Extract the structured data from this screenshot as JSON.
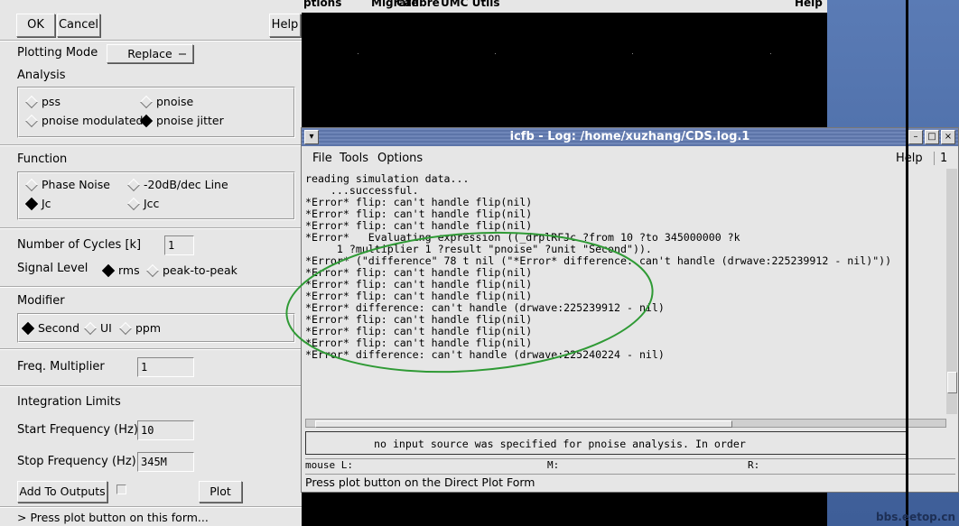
{
  "form": {
    "ok": "OK",
    "cancel": "Cancel",
    "help": "Help",
    "plotting_mode_label": "Plotting Mode",
    "plotting_mode_value": "Replace",
    "analysis_label": "Analysis",
    "analysis_options": [
      "pss",
      "pnoise",
      "pnoise modulated",
      "pnoise jitter"
    ],
    "analysis_selected": "pnoise jitter",
    "function_label": "Function",
    "function_options": [
      "Phase Noise",
      "-20dB/dec Line",
      "Jc",
      "Jcc"
    ],
    "function_selected": "Jc",
    "cycles_label": "Number of Cycles [k]",
    "cycles_value": "1",
    "signal_level_label": "Signal Level",
    "signal_options": [
      "rms",
      "peak-to-peak"
    ],
    "signal_selected": "rms",
    "modifier_label": "Modifier",
    "modifier_options": [
      "Second",
      "UI",
      "ppm"
    ],
    "modifier_selected": "Second",
    "freq_mult_label": "Freq. Multiplier",
    "freq_mult_value": "1",
    "integration_label": "Integration Limits",
    "start_freq_label": "Start Frequency (Hz)",
    "start_freq_value": "10",
    "stop_freq_label": "Stop Frequency (Hz)",
    "stop_freq_value": "345M",
    "add_outputs": "Add To Outputs",
    "plot": "Plot",
    "status": "> Press plot button on this form..."
  },
  "wave_menu": [
    "ptions",
    "Migrate",
    "Calibre",
    "UMC Utils"
  ],
  "wave_help": "Help",
  "log": {
    "title": "icfb - Log: /home/xuzhang/CDS.log.1",
    "menu": [
      "File",
      "Tools",
      "Options"
    ],
    "help": "Help",
    "counter": "1",
    "lines": [
      "reading simulation data...",
      "    ...successful.",
      "*Error* flip: can't handle flip(nil)",
      "*Error* flip: can't handle flip(nil)",
      "*Error* flip: can't handle flip(nil)",
      "*Error*   Evaluating expression ((_drplRFJc ?from 10 ?to 345000000 ?k",
      "     1 ?multiplier 1 ?result \"pnoise\" ?unit \"Second\")).",
      "*Error* (\"difference\" 78 t nil (\"*Error* difference: can't handle (drwave:225239912 - nil)\"))",
      "*Error* flip: can't handle flip(nil)",
      "*Error* flip: can't handle flip(nil)",
      "*Error* flip: can't handle flip(nil)",
      "*Error* difference: can't handle (drwave:225239912 - nil)",
      "*Error* flip: can't handle flip(nil)",
      "*Error* flip: can't handle flip(nil)",
      "*Error* flip: can't handle flip(nil)",
      "*Error* difference: can't handle (drwave:225240224 - nil)"
    ],
    "prompt": "no input source was specified for pnoise analysis. In order",
    "mouse_l": "mouse L:",
    "mouse_m": "M:",
    "mouse_r": "R:",
    "status": "Press plot button on the Direct Plot Form"
  },
  "watermark": "bbs.eetop.cn"
}
